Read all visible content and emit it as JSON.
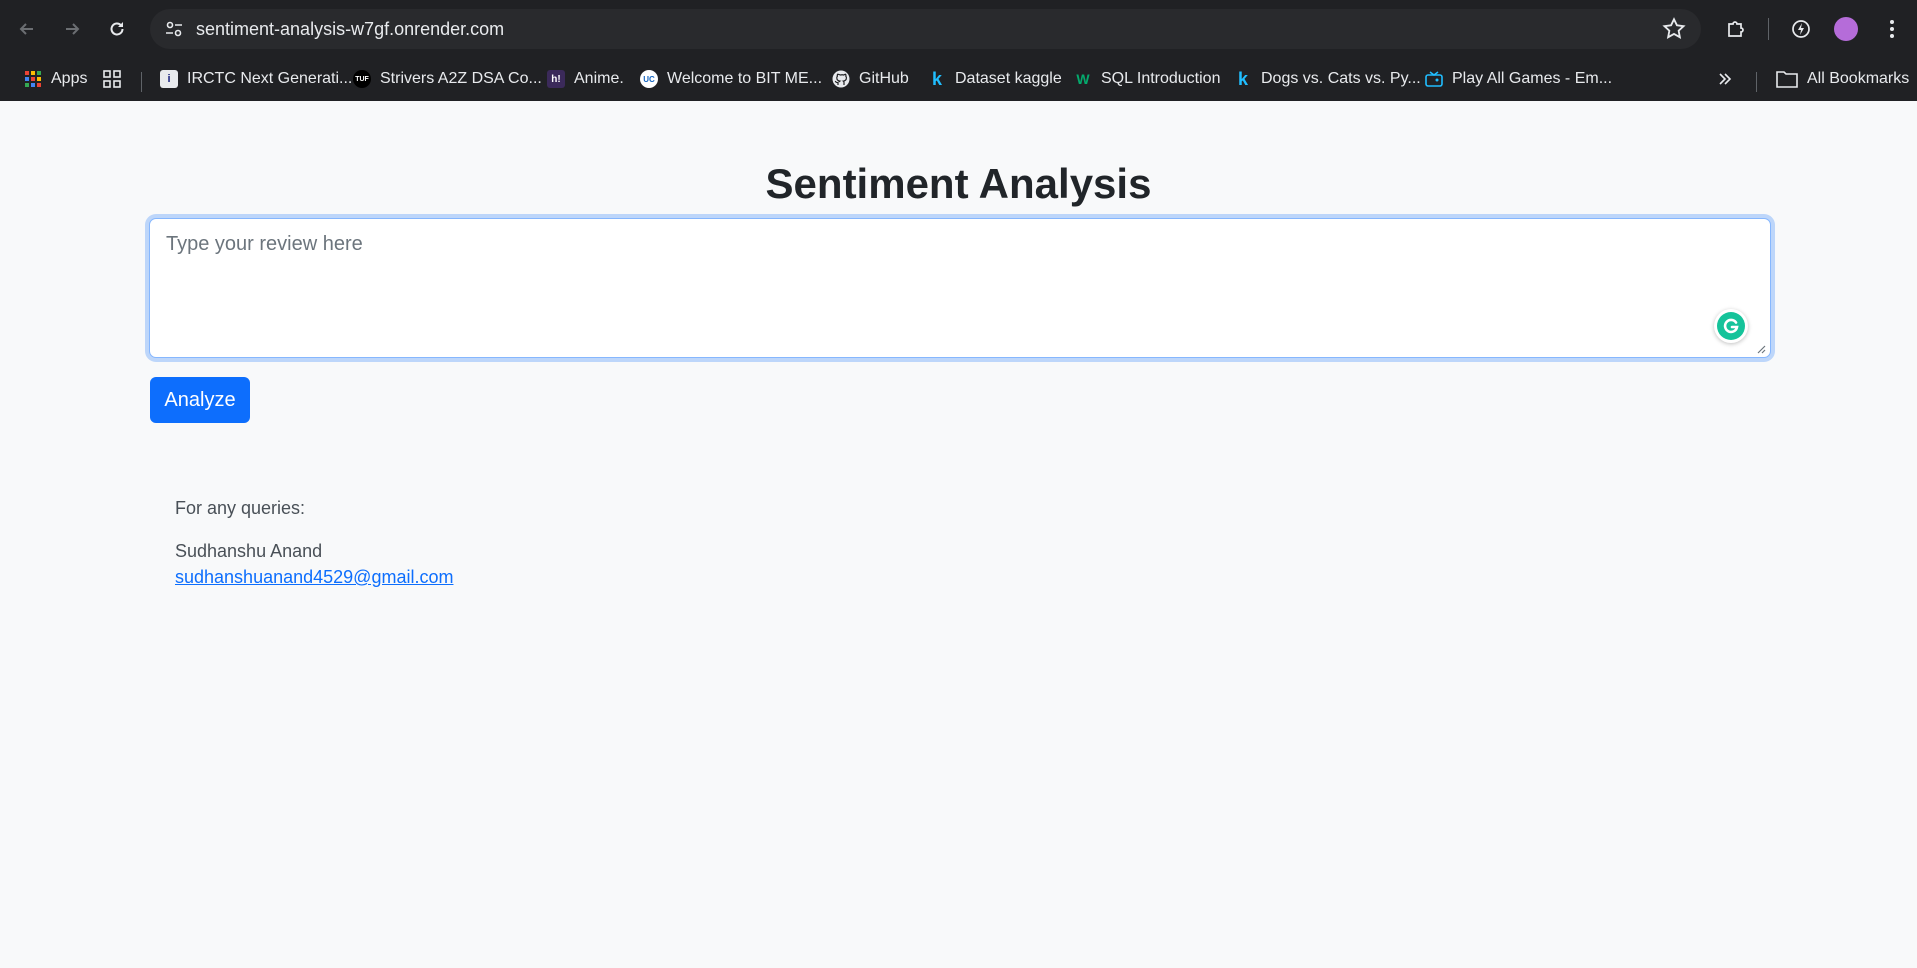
{
  "browser": {
    "url": "sentiment-analysis-w7gf.onrender.com",
    "bookmarks": [
      {
        "label": "Apps",
        "icon": "apps-grid-icon"
      },
      {
        "label": "IRCTC Next Generati...",
        "icon": "irctc-icon"
      },
      {
        "label": "Strivers A2Z DSA Co...",
        "icon": "tuf-icon",
        "badge": "TUF"
      },
      {
        "label": "Anime.",
        "icon": "hianime-icon",
        "badge": "h!"
      },
      {
        "label": "Welcome to BIT ME...",
        "icon": "bit-icon",
        "badge": "UC"
      },
      {
        "label": "GitHub",
        "icon": "github-icon"
      },
      {
        "label": "Dataset kaggle",
        "icon": "kaggle-icon",
        "badge": "k"
      },
      {
        "label": "SQL Introduction",
        "icon": "w3schools-icon",
        "badge": "W"
      },
      {
        "label": "Dogs vs. Cats vs. Py...",
        "icon": "kaggle-icon",
        "badge": "k"
      },
      {
        "label": "Play All Games - Em...",
        "icon": "games-icon"
      }
    ],
    "all_bookmarks": "All Bookmarks"
  },
  "page": {
    "title": "Sentiment Analysis",
    "review_placeholder": "Type your review here",
    "analyze_label": "Analyze",
    "contact": {
      "queries": "For any queries:",
      "name": "Sudhanshu Anand",
      "email": "sudhanshuanand4529@gmail.com"
    }
  },
  "colors": {
    "chrome_bg": "#202124",
    "page_bg": "#f8f9fa",
    "primary": "#0d6efd",
    "grammarly": "#15c39a"
  }
}
